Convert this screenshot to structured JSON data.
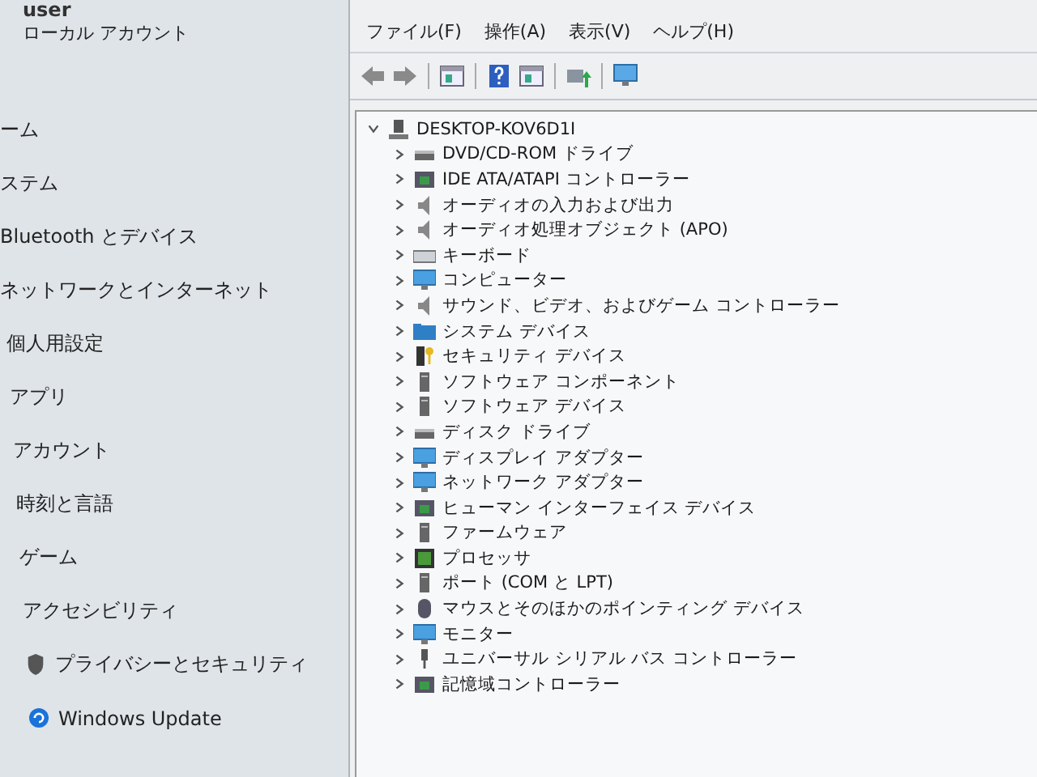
{
  "settings": {
    "user": {
      "name": "user",
      "account_type": "ローカル アカウント"
    },
    "nav_items": [
      "ーム",
      "ステム",
      "Bluetooth とデバイス",
      "ネットワークとインターネット",
      "個人用設定",
      "アプリ",
      "アカウント",
      "時刻と言語",
      "ゲーム",
      "アクセシビリティ",
      "プライバシーとセキュリティ",
      "Windows Update"
    ]
  },
  "device_manager": {
    "menu": [
      "ファイル(F)",
      "操作(A)",
      "表示(V)",
      "ヘルプ(H)"
    ],
    "toolbar": [
      {
        "kind": "back"
      },
      {
        "kind": "forward"
      },
      {
        "kind": "sep"
      },
      {
        "kind": "panel"
      },
      {
        "kind": "sep"
      },
      {
        "kind": "help"
      },
      {
        "kind": "panel"
      },
      {
        "kind": "sep"
      },
      {
        "kind": "update"
      },
      {
        "kind": "sep"
      },
      {
        "kind": "monitor"
      }
    ],
    "tree": {
      "label": "DESKTOP-KOV6D1I",
      "expanded": true,
      "children": [
        {
          "label": "DVD/CD-ROM ドライブ",
          "kind": "drive",
          "expanded": false
        },
        {
          "label": "IDE ATA/ATAPI コントローラー",
          "kind": "chip",
          "expanded": false
        },
        {
          "label": "オーディオの入力および出力",
          "kind": "speaker",
          "expanded": false
        },
        {
          "label": "オーディオ処理オブジェクト (APO)",
          "kind": "speaker",
          "expanded": false
        },
        {
          "label": "キーボード",
          "kind": "keyboard",
          "expanded": false
        },
        {
          "label": "コンピューター",
          "kind": "monitor",
          "expanded": false
        },
        {
          "label": "サウンド、ビデオ、およびゲーム コントローラー",
          "kind": "speaker",
          "expanded": false
        },
        {
          "label": "システム デバイス",
          "kind": "folder",
          "expanded": false
        },
        {
          "label": "セキュリティ デバイス",
          "kind": "key",
          "expanded": false
        },
        {
          "label": "ソフトウェア コンポーネント",
          "kind": "tower",
          "expanded": false
        },
        {
          "label": "ソフトウェア デバイス",
          "kind": "tower",
          "expanded": false
        },
        {
          "label": "ディスク ドライブ",
          "kind": "drive",
          "expanded": false
        },
        {
          "label": "ディスプレイ アダプター",
          "kind": "monitor",
          "expanded": false
        },
        {
          "label": "ネットワーク アダプター",
          "kind": "monitor",
          "expanded": false
        },
        {
          "label": "ヒューマン インターフェイス デバイス",
          "kind": "chip",
          "expanded": false
        },
        {
          "label": "ファームウェア",
          "kind": "tower",
          "expanded": false
        },
        {
          "label": "プロセッサ",
          "kind": "cpu",
          "expanded": false
        },
        {
          "label": "ポート (COM と LPT)",
          "kind": "tower",
          "expanded": false
        },
        {
          "label": "マウスとそのほかのポインティング デバイス",
          "kind": "mouse",
          "expanded": false
        },
        {
          "label": "モニター",
          "kind": "monitor",
          "expanded": false
        },
        {
          "label": "ユニバーサル シリアル バス コントローラー",
          "kind": "usb",
          "expanded": false
        },
        {
          "label": "記憶域コントローラー",
          "kind": "chip",
          "expanded": false
        }
      ]
    }
  }
}
